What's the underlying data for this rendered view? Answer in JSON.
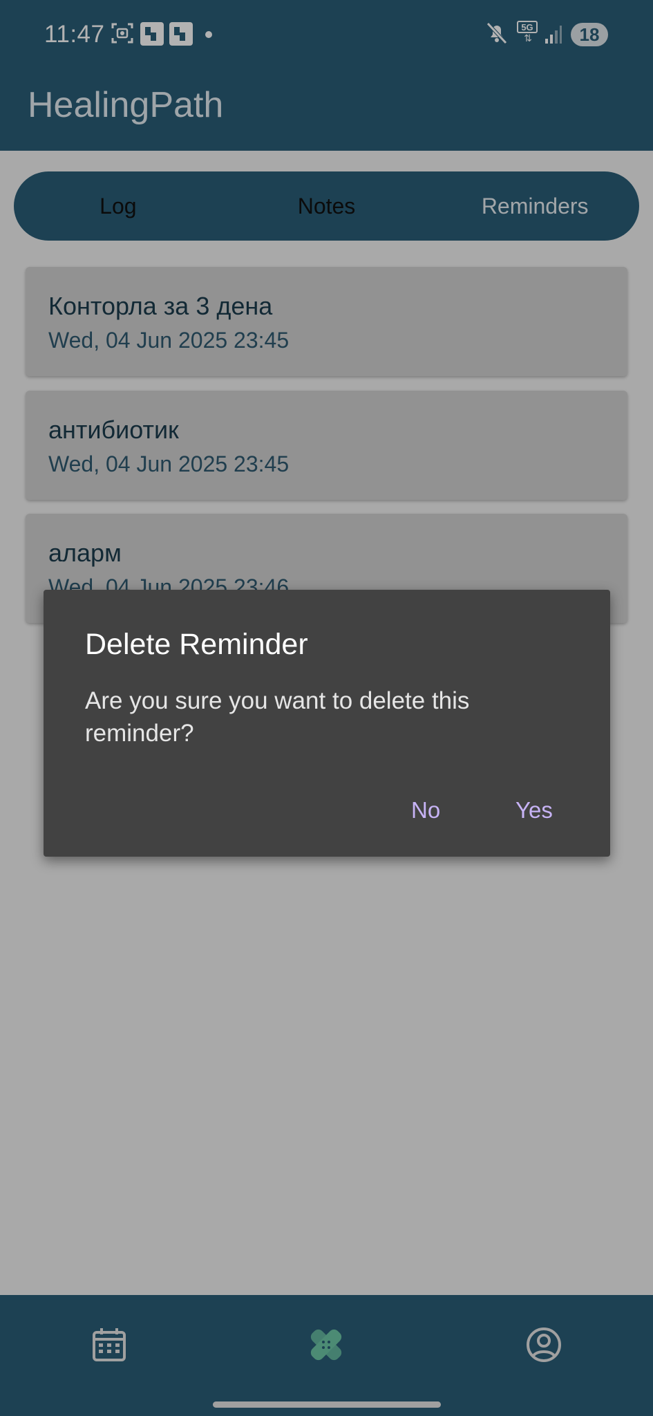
{
  "status_bar": {
    "time": "11:47",
    "network": "5G",
    "battery": "18",
    "icons": [
      "screenshot-icon",
      "healingpath-notification-icon",
      "healingpath-notification-icon",
      "notification-dot",
      "mute-icon",
      "5g-icon",
      "signal-icon",
      "battery-icon"
    ]
  },
  "app_bar": {
    "title": "HealingPath"
  },
  "tabs": [
    {
      "label": "Log"
    },
    {
      "label": "Notes"
    },
    {
      "label": "Reminders"
    }
  ],
  "active_tab": "Reminders",
  "reminders": [
    {
      "title": "Конторла за 3 дена",
      "date": "Wed, 04 Jun 2025 23:45"
    },
    {
      "title": "антибиотик",
      "date": "Wed, 04 Jun 2025 23:45"
    },
    {
      "title": "аларм",
      "date": "Wed, 04 Jun 2025 23:46"
    }
  ],
  "dialog": {
    "title": "Delete Reminder",
    "message": "Are you sure you want to delete this reminder?",
    "no_label": "No",
    "yes_label": "Yes"
  },
  "bottom_nav": {
    "items": [
      {
        "icon": "calendar-icon"
      },
      {
        "icon": "bandage-icon"
      },
      {
        "icon": "profile-icon"
      }
    ]
  },
  "colors": {
    "primary": "#2a5d77",
    "card": "#d2d2d2",
    "dialog": "#424242",
    "dialog_button": "#c7b3f5"
  }
}
